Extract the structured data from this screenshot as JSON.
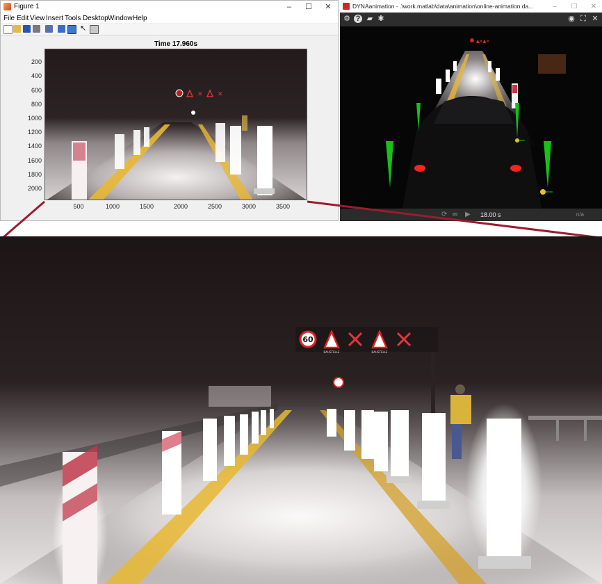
{
  "figure_window": {
    "title": "Figure 1",
    "menu": [
      "File",
      "Edit",
      "View",
      "Insert",
      "Tools",
      "Desktop",
      "Window",
      "Help"
    ],
    "toolbar_icons": [
      "new-figure-icon",
      "open-icon",
      "save-icon",
      "print-icon",
      "print-preview-icon",
      "link-icon",
      "insert-colorbar-icon",
      "pointer-icon",
      "property-editor-icon"
    ],
    "window_controls": [
      "–",
      "☐",
      "✕"
    ],
    "plot": {
      "title": "Time 17.960s",
      "y_ticks": [
        "200",
        "400",
        "600",
        "800",
        "1000",
        "1200",
        "1400",
        "1600",
        "1800",
        "2000"
      ],
      "x_ticks": [
        "500",
        "1000",
        "1500",
        "2000",
        "2500",
        "3000",
        "3500"
      ]
    }
  },
  "dyna_window": {
    "title": "DYNAanimation  -  .\\work.matlab\\data\\animation\\online-animation.da...",
    "window_controls": [
      "–",
      "☐",
      "✕"
    ],
    "toolbar_left": [
      "settings-icon",
      "help-icon",
      "open-folder-icon",
      "bug-icon"
    ],
    "toolbar_right": [
      "eye-icon",
      "fullscreen-icon",
      "close-icon"
    ],
    "time": "18.00 s",
    "na_label": "n/a"
  },
  "sign_gantry": {
    "speed_limit": "60",
    "sign_caption": "BAUSTELLE"
  },
  "colors": {
    "connector": "#9b1b30",
    "road_line_yellow": "#e8b833",
    "signal_green": "#18c018",
    "tail_light_red": "#ff2222"
  }
}
